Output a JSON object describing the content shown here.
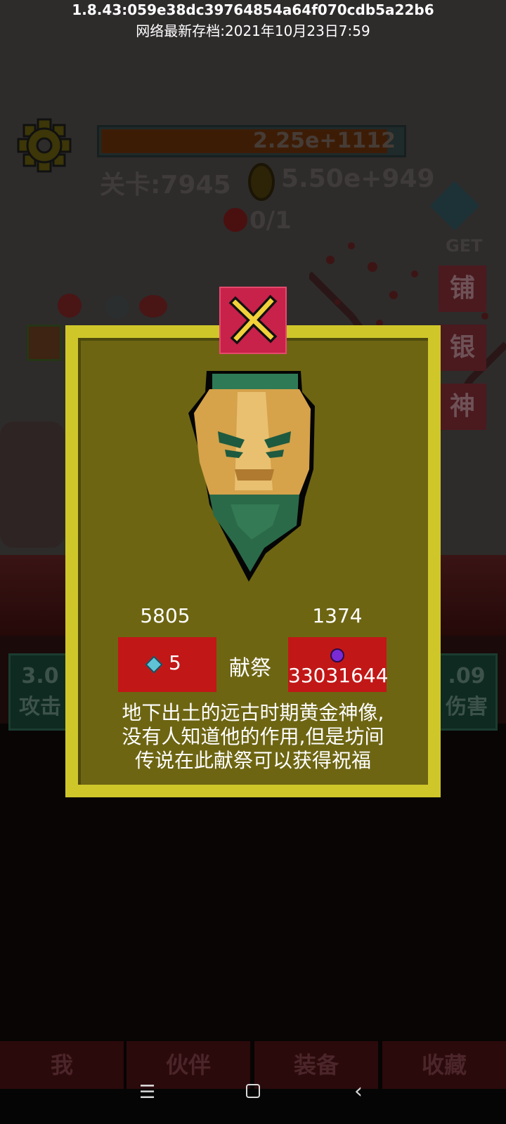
{
  "header": {
    "version": "1.8.43:059e38dc39764854a64f070cdb5a22b6",
    "save_time": "网络最新存档:2021年10月23日7:59"
  },
  "hud": {
    "hp_value": "2.25e+1112",
    "hp_fraction": 0.95,
    "level": "关卡:7945",
    "gold": "5.50e+949",
    "kills": "0/1",
    "get_label": "GET",
    "side_buttons": [
      "铺",
      "银",
      "神"
    ],
    "stat_left": [
      "3.0",
      "攻击"
    ],
    "stat_right": [
      ".09",
      "伤害"
    ]
  },
  "dialog": {
    "gem_count": "5805",
    "orb_count": "1374",
    "gem_cost": "5",
    "sacrifice_label": "献祭",
    "orb_cost": "33031644",
    "description_lines": [
      "地下出土的远古时期黄金神像,",
      "没有人知道他的作用,但是坊间",
      "传说在此献祭可以获得祝福"
    ]
  },
  "tabs": [
    "我",
    "伙伴",
    "装备",
    "收藏"
  ],
  "colors": {
    "dialog_border": "#cfc62a",
    "dialog_fill": "#6d6512",
    "button_red": "#c21717",
    "close_button": "#c8214a"
  },
  "icons": {
    "close": "close-x-icon",
    "statue": "golden-statue-icon",
    "gem": "gem-icon",
    "orb": "purple-orb-icon",
    "settings": "gear-icon"
  }
}
